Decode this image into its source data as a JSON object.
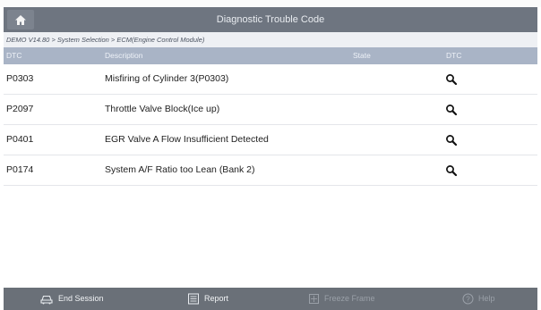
{
  "header": {
    "title": "Diagnostic Trouble Code"
  },
  "breadcrumb": "DEMO V14.80 > System Selection > ECM(Engine Control Module)",
  "columns": [
    "DTC",
    "Description",
    "State",
    "DTC"
  ],
  "rows": [
    {
      "code": "P0303",
      "description": "Misfiring of Cylinder 3(P0303)",
      "state": ""
    },
    {
      "code": "P2097",
      "description": "Throttle Valve Block(Ice up)",
      "state": ""
    },
    {
      "code": "P0401",
      "description": "EGR Valve A Flow Insufficient Detected",
      "state": ""
    },
    {
      "code": "P0174",
      "description": "System A/F Ratio too Lean (Bank 2)",
      "state": ""
    }
  ],
  "footer": {
    "end_session": "End Session",
    "report": "Report",
    "freeze_frame": "Freeze Frame",
    "help": "Help"
  },
  "icons": {
    "home": "home-icon",
    "search": "magnifier-icon",
    "end_session": "car-outline-icon",
    "report": "document-icon",
    "freeze_frame": "snowflake-icon",
    "help": "question-icon"
  },
  "colors": {
    "header_bg": "#6e7580",
    "column_header_bg": "#a9b4c6",
    "footer_bg": "#6a7078",
    "footer_disabled_text": "#9aa0a8"
  }
}
